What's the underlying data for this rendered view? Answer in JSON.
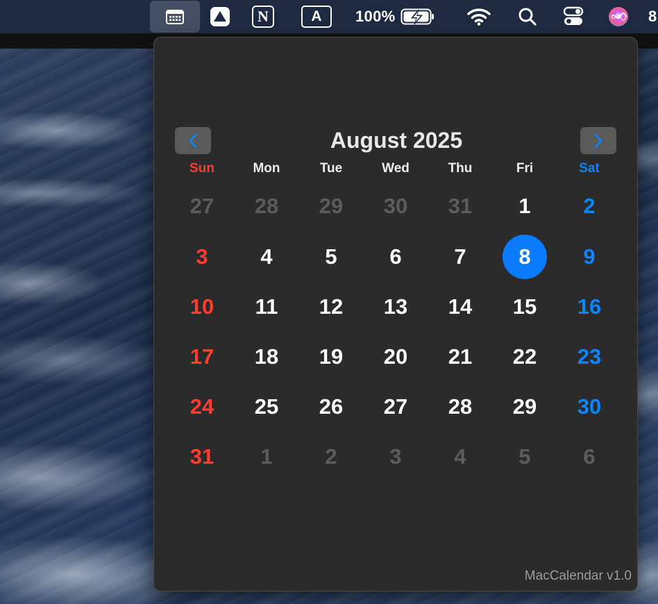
{
  "menubar": {
    "battery_percent": "100%",
    "clipped_text": "8",
    "icons": [
      "calendar-icon",
      "drive-icon",
      "notion-icon",
      "input-source-icon",
      "battery-charging-icon",
      "wifi-icon",
      "spotlight-search-icon",
      "control-center-icon",
      "siri-icon"
    ],
    "input_source_letter": "A",
    "notion_letter": "N"
  },
  "calendar": {
    "month_title": "August 2025",
    "weekdays": [
      "Sun",
      "Mon",
      "Tue",
      "Wed",
      "Thu",
      "Fri",
      "Sat"
    ],
    "weeks": [
      [
        "27",
        "28",
        "29",
        "30",
        "31",
        "1",
        "2"
      ],
      [
        "3",
        "4",
        "5",
        "6",
        "7",
        "8",
        "9"
      ],
      [
        "10",
        "11",
        "12",
        "13",
        "14",
        "15",
        "16"
      ],
      [
        "17",
        "18",
        "19",
        "20",
        "21",
        "22",
        "23"
      ],
      [
        "24",
        "25",
        "26",
        "27",
        "28",
        "29",
        "30"
      ],
      [
        "31",
        "1",
        "2",
        "3",
        "4",
        "5",
        "6"
      ]
    ],
    "today": "8",
    "colors": {
      "sunday": "#ff3b30",
      "saturday": "#0a84ff",
      "today_bg": "#0a7bff",
      "other_month": "#5c5c5c"
    }
  },
  "footer": {
    "version_label": "MacCalendar v1.0"
  }
}
